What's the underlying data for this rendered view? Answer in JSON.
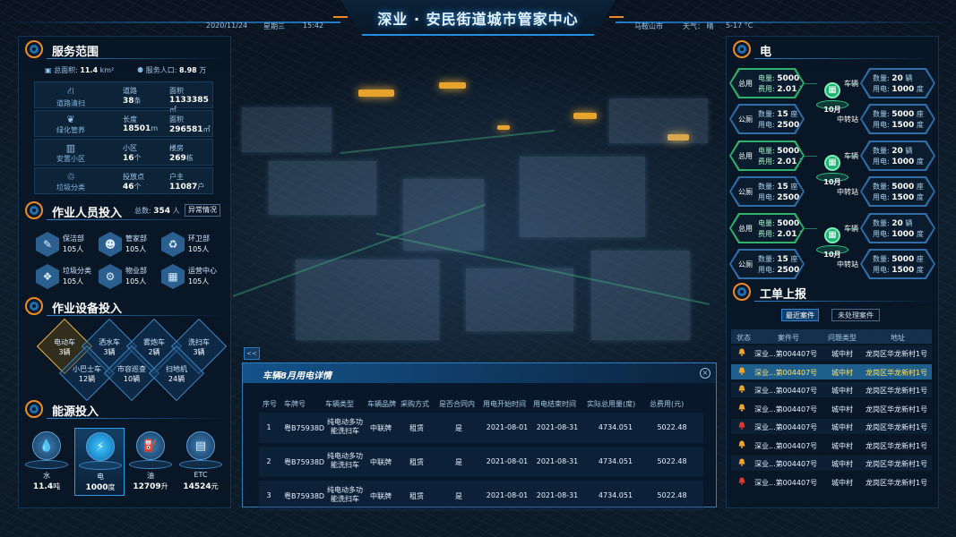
{
  "header": {
    "title": "深业 · 安民街道城市管家中心",
    "date": "2020/11/24",
    "weekday": "星期三",
    "time": "15:42",
    "city": "马鞍山市",
    "weather": "天气： 晴",
    "temperature": "5-17 °C"
  },
  "service": {
    "title": "服务范围",
    "area_label": "总面积:",
    "area_value": "11.4",
    "area_unit": "km²",
    "pop_label": "服务人口:",
    "pop_value": "8.98",
    "pop_unit": "万",
    "rows": [
      {
        "name": "道路清扫",
        "k1": "道路",
        "v1": "38",
        "u1": "条",
        "k2": "面积",
        "v2": "1133385",
        "u2": "㎡"
      },
      {
        "name": "绿化管养",
        "k1": "长度",
        "v1": "18501",
        "u1": "m",
        "k2": "面积",
        "v2": "296581",
        "u2": "㎡"
      },
      {
        "name": "安置小区",
        "k1": "小区",
        "v1": "16",
        "u1": "个",
        "k2": "楼房",
        "v2": "269",
        "u2": "栋"
      },
      {
        "name": "垃圾分类",
        "k1": "投放点",
        "v1": "46",
        "u1": "个",
        "k2": "户主",
        "v2": "11087",
        "u2": "户"
      }
    ]
  },
  "staff": {
    "title": "作业人员投入",
    "total_label": "总数:",
    "total_value": "354",
    "total_unit": "人",
    "abnormal_button": "异常情况",
    "items": [
      {
        "name": "保洁部",
        "count": "105人",
        "icon": "sweeper-icon"
      },
      {
        "name": "管家部",
        "count": "105人",
        "icon": "butler-icon"
      },
      {
        "name": "环卫部",
        "count": "105人",
        "icon": "recycle-icon"
      },
      {
        "name": "垃圾分类",
        "count": "105人",
        "icon": "sorting-icon"
      },
      {
        "name": "物业部",
        "count": "105人",
        "icon": "property-icon"
      },
      {
        "name": "运营中心",
        "count": "105人",
        "icon": "operation-icon"
      }
    ]
  },
  "equipment": {
    "title": "作业设备投入",
    "items": [
      {
        "name": "电动车",
        "count": "3辆",
        "active": true
      },
      {
        "name": "洒水车",
        "count": "3辆",
        "active": false
      },
      {
        "name": "雾炮车",
        "count": "2辆",
        "active": false
      },
      {
        "name": "洗扫车",
        "count": "3辆",
        "active": false
      },
      {
        "name": "小巴士车",
        "count": "12辆",
        "active": false
      },
      {
        "name": "市容巡查",
        "count": "10辆",
        "active": false
      },
      {
        "name": "扫地机",
        "count": "24辆",
        "active": false
      }
    ]
  },
  "energy": {
    "title": "能源投入",
    "items": [
      {
        "name": "水",
        "value": "11.4",
        "unit": "吨",
        "icon": "water-drop-icon"
      },
      {
        "name": "电",
        "value": "1000",
        "unit": "度",
        "icon": "lightning-icon"
      },
      {
        "name": "油",
        "value": "12709",
        "unit": "升",
        "icon": "fuel-icon"
      },
      {
        "name": "ETC",
        "value": "14524",
        "unit": "元",
        "icon": "etc-card-icon"
      }
    ]
  },
  "electricity": {
    "title": "电",
    "groups": [
      {
        "month": "10月",
        "left": [
          {
            "name": "总用",
            "r1k": "电量:",
            "r1v": "5000",
            "r1u": "度",
            "r2k": "费用:",
            "r2v": "2.01",
            "r2u": "万元",
            "green": true
          },
          {
            "name": "公厕",
            "r1k": "数量:",
            "r1v": "15",
            "r1u": "座",
            "r2k": "用电:",
            "r2v": "2500",
            "r2u": "度",
            "green": false
          }
        ],
        "right": [
          {
            "name": "车辆",
            "r1k": "数量:",
            "r1v": "20",
            "r1u": "辆",
            "r2k": "用电:",
            "r2v": "1000",
            "r2u": "度"
          },
          {
            "name": "中转站",
            "r1k": "数量:",
            "r1v": "5000",
            "r1u": "座",
            "r2k": "用电:",
            "r2v": "1500",
            "r2u": "度"
          }
        ]
      },
      {
        "month": "10月",
        "left": [
          {
            "name": "总用",
            "r1k": "电量:",
            "r1v": "5000",
            "r1u": "度",
            "r2k": "费用:",
            "r2v": "2.01",
            "r2u": "万元",
            "green": true
          },
          {
            "name": "公厕",
            "r1k": "数量:",
            "r1v": "15",
            "r1u": "座",
            "r2k": "用电:",
            "r2v": "2500",
            "r2u": "度",
            "green": false
          }
        ],
        "right": [
          {
            "name": "车辆",
            "r1k": "数量:",
            "r1v": "20",
            "r1u": "辆",
            "r2k": "用电:",
            "r2v": "1000",
            "r2u": "度"
          },
          {
            "name": "中转站",
            "r1k": "数量:",
            "r1v": "5000",
            "r1u": "座",
            "r2k": "用电:",
            "r2v": "1500",
            "r2u": "度"
          }
        ]
      },
      {
        "month": "10月",
        "left": [
          {
            "name": "总用",
            "r1k": "电量:",
            "r1v": "5000",
            "r1u": "度",
            "r2k": "费用:",
            "r2v": "2.01",
            "r2u": "万元",
            "green": true
          },
          {
            "name": "公厕",
            "r1k": "数量:",
            "r1v": "15",
            "r1u": "座",
            "r2k": "用电:",
            "r2v": "2500",
            "r2u": "度",
            "green": false
          }
        ],
        "right": [
          {
            "name": "车辆",
            "r1k": "数量:",
            "r1v": "20",
            "r1u": "辆",
            "r2k": "用电:",
            "r2v": "1000",
            "r2u": "度"
          },
          {
            "name": "中转站",
            "r1k": "数量:",
            "r1v": "5000",
            "r1u": "座",
            "r2k": "用电:",
            "r2v": "1500",
            "r2u": "度"
          }
        ]
      }
    ]
  },
  "orders": {
    "title": "工单上报",
    "tabs": [
      "最近案件",
      "未处理案件"
    ],
    "columns": [
      "状态",
      "案件号",
      "问题类型",
      "地址"
    ],
    "rows": [
      {
        "status": "orange",
        "case": "深业...第004407号",
        "type": "城中村",
        "addr": "龙岗区华龙新村1号"
      },
      {
        "status": "orange",
        "case": "深业...第004407号",
        "type": "城中村",
        "addr": "龙岗区华龙新村1号",
        "highlight": true
      },
      {
        "status": "orange",
        "case": "深业...第004407号",
        "type": "城中村",
        "addr": "龙岗区华龙新村1号"
      },
      {
        "status": "orange",
        "case": "深业...第004407号",
        "type": "城中村",
        "addr": "龙岗区华龙新村1号"
      },
      {
        "status": "red",
        "case": "深业...第004407号",
        "type": "城中村",
        "addr": "龙岗区华龙新村1号"
      },
      {
        "status": "orange",
        "case": "深业...第004407号",
        "type": "城中村",
        "addr": "龙岗区华龙新村1号"
      },
      {
        "status": "orange",
        "case": "深业...第004407号",
        "type": "城中村",
        "addr": "龙岗区华龙新村1号"
      },
      {
        "status": "red",
        "case": "深业...第004407号",
        "type": "城中村",
        "addr": "龙岗区华龙新村1号"
      }
    ],
    "colors": {
      "orange": "#f5a623",
      "red": "#e03a2a"
    }
  },
  "popup": {
    "title": "车辆8月用电详情",
    "collapse_label": "<<",
    "columns": [
      "序号",
      "车牌号",
      "车辆类型",
      "车辆品牌",
      "采购方式",
      "是否合同内",
      "用电开始时间",
      "用电结束时间",
      "实际总用量(度)",
      "总费用(元)"
    ],
    "rows": [
      [
        "1",
        "粤B75938D",
        "纯电动多功能洗扫车",
        "中联牌",
        "租赁",
        "是",
        "2021-08-01",
        "2021-08-31",
        "4734.051",
        "5022.48"
      ],
      [
        "2",
        "粤B75938D",
        "纯电动多功能洗扫车",
        "中联牌",
        "租赁",
        "是",
        "2021-08-01",
        "2021-08-31",
        "4734.051",
        "5022.48"
      ],
      [
        "3",
        "粤B75938D",
        "纯电动多功能洗扫车",
        "中联牌",
        "租赁",
        "是",
        "2021-08-01",
        "2021-08-31",
        "4734.051",
        "5022.48"
      ]
    ]
  }
}
